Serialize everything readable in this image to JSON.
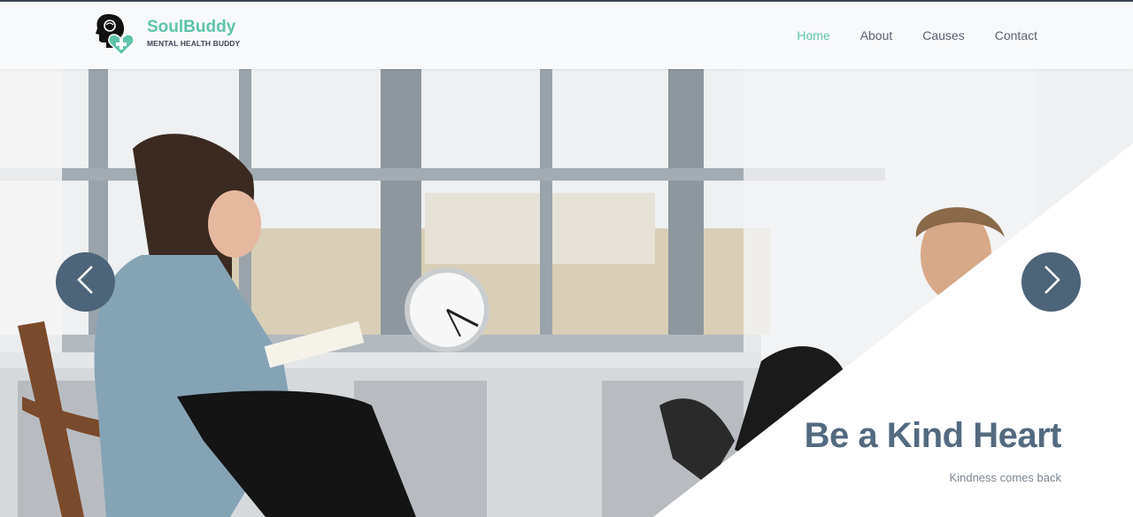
{
  "brand": {
    "name": "SoulBuddy",
    "tagline": "MENTAL HEALTH BUDDY",
    "accent_color": "#5ec3aa",
    "logo_icon": "head-heart-plus-icon"
  },
  "nav": {
    "items": [
      {
        "label": "Home",
        "active": true
      },
      {
        "label": "About",
        "active": false
      },
      {
        "label": "Causes",
        "active": false
      },
      {
        "label": "Contact",
        "active": false
      }
    ]
  },
  "hero": {
    "title": "Be a Kind Heart",
    "subtitle": "Kindness comes back",
    "title_color": "#546a7f",
    "prev_icon": "chevron-left-icon",
    "next_icon": "chevron-right-icon",
    "arrow_color": "#4e6478"
  }
}
